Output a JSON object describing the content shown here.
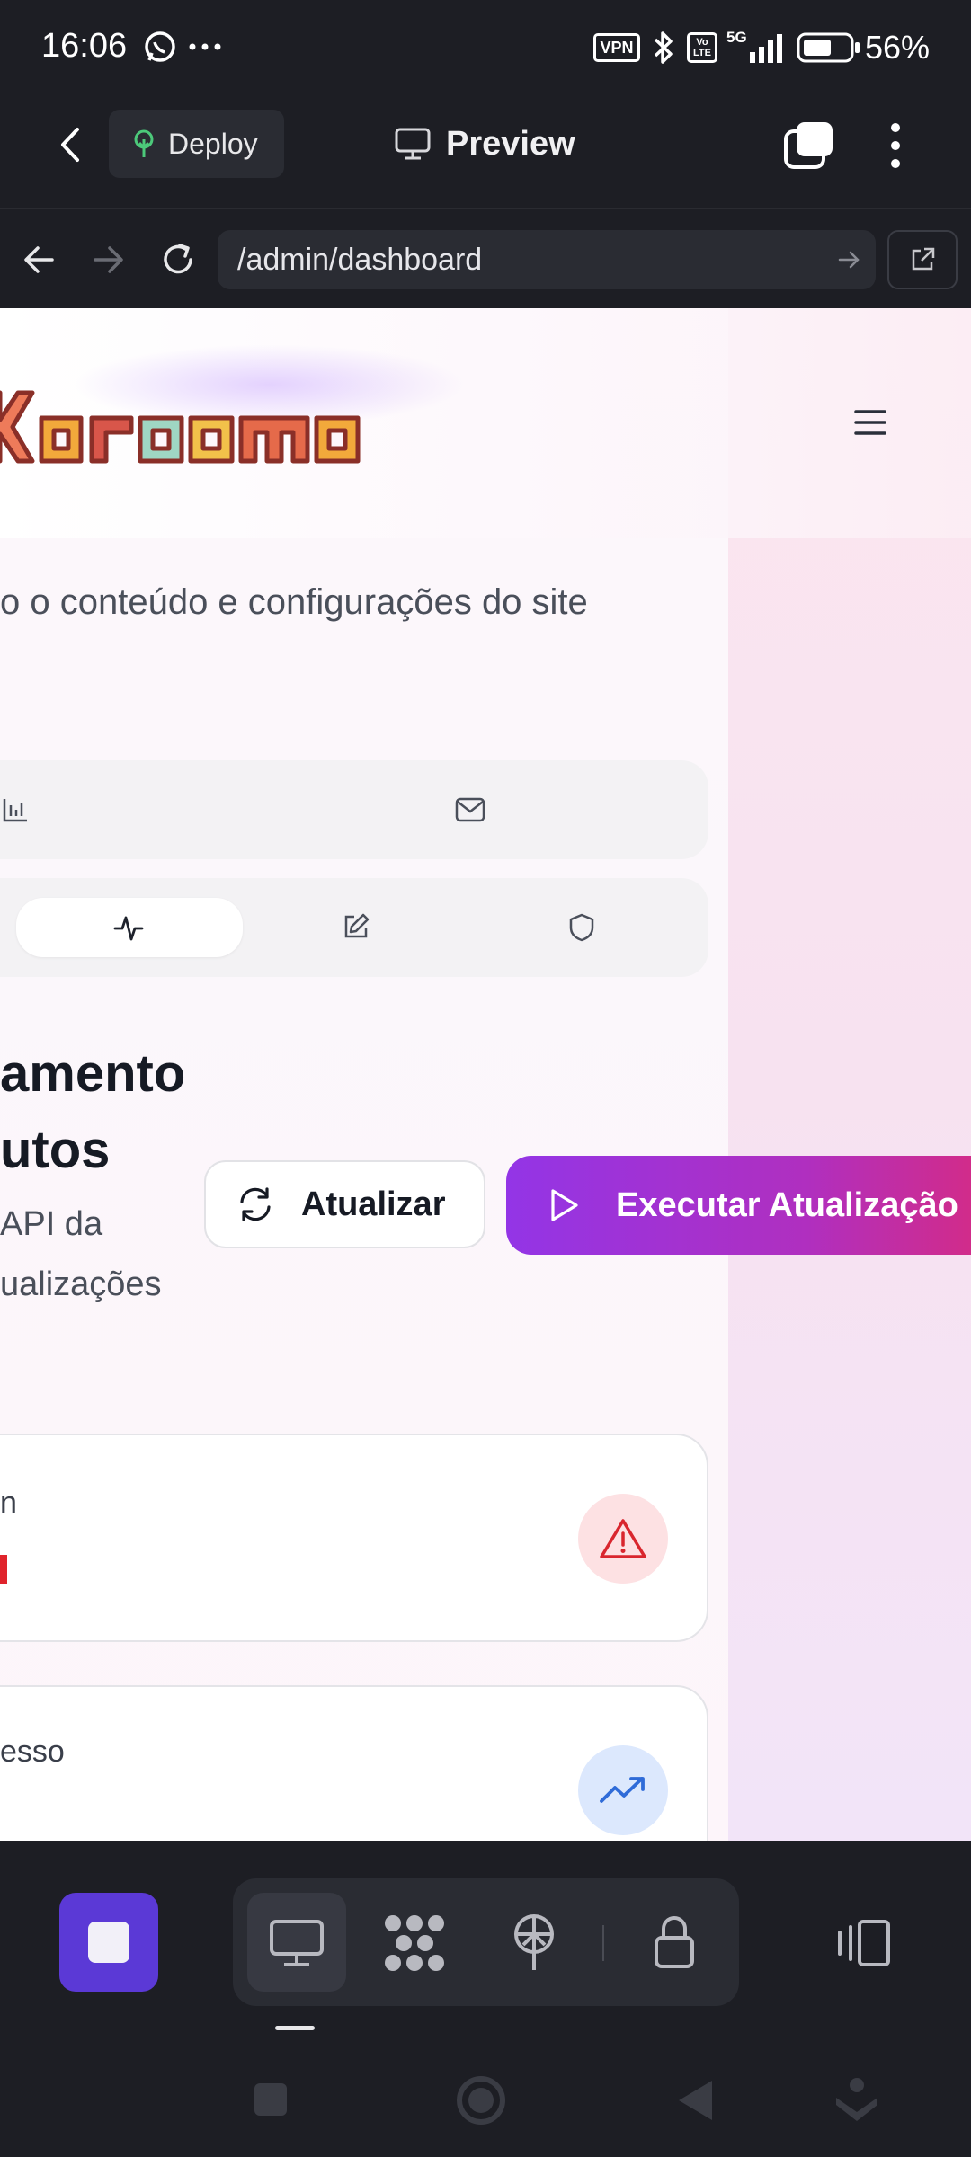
{
  "status_bar": {
    "time": "16:06",
    "battery": "56%",
    "vpn_label": "VPN",
    "network": "5G",
    "volte": "Vo LTE",
    "icons": [
      "whatsapp-icon",
      "more-dots-icon",
      "bluetooth-icon",
      "signal-icon",
      "battery-icon"
    ]
  },
  "app_header": {
    "deploy_label": "Deploy",
    "preview_label": "Preview"
  },
  "browser": {
    "url": "/admin/dashboard"
  },
  "page": {
    "logo_text": "Karooma",
    "subtitle": "o o conteúdo e configurações do site",
    "section_heading_line1": "amento",
    "section_heading_line2": "utos",
    "section_desc_line1": " API da",
    "section_desc_line2": "ualizações",
    "refresh_label": "Atualizar",
    "run_label": "Executar Atualização",
    "card1_label": "n",
    "card2_label": "esso",
    "colors": {
      "accent_purple": "#9335e6",
      "accent_pink": "#d92b7e",
      "warning_red": "#e0242c",
      "trend_blue": "#2f6bd8"
    }
  },
  "bottom_toolbar": {
    "icons": [
      "stop-icon",
      "desktop-icon",
      "nodes-icon",
      "publish-icon",
      "lock-icon",
      "device-switch-icon"
    ]
  },
  "nav_bar": {
    "icons": [
      "recents-square-icon",
      "home-circle-icon",
      "back-triangle-icon",
      "assistant-icon"
    ]
  }
}
